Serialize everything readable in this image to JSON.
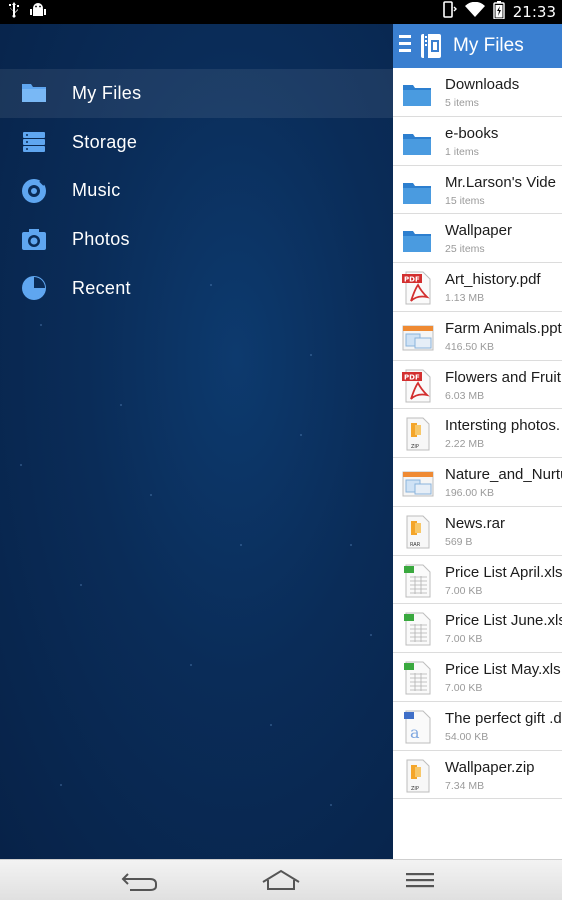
{
  "status_bar": {
    "time": "21:33",
    "left_icons": [
      "usb-icon",
      "android-debug-icon"
    ],
    "right_icons": [
      "rotation-icon",
      "wifi-icon",
      "battery-icon"
    ]
  },
  "drawer": {
    "items": [
      {
        "label": "My Files",
        "icon": "folder-icon",
        "active": true
      },
      {
        "label": "Storage",
        "icon": "storage-icon",
        "active": false
      },
      {
        "label": "Music",
        "icon": "music-icon",
        "active": false
      },
      {
        "label": "Photos",
        "icon": "camera-icon",
        "active": false
      },
      {
        "label": "Recent",
        "icon": "recent-icon",
        "active": false
      }
    ]
  },
  "action_bar": {
    "title": "My Files",
    "accent": "#3a7fd0"
  },
  "files": [
    {
      "name": "Downloads",
      "meta": "5 items",
      "type": "folder"
    },
    {
      "name": "e-books",
      "meta": "1 items",
      "type": "folder"
    },
    {
      "name": "Mr.Larson's Vide",
      "meta": "15 items",
      "type": "folder"
    },
    {
      "name": "Wallpaper",
      "meta": "25 items",
      "type": "folder"
    },
    {
      "name": "Art_history.pdf",
      "meta": "1.13 MB",
      "type": "pdf"
    },
    {
      "name": "Farm Animals.ppt",
      "meta": "416.50 KB",
      "type": "ppt"
    },
    {
      "name": "Flowers and Fruit",
      "meta": "6.03 MB",
      "type": "pdf"
    },
    {
      "name": "Intersting photos.",
      "meta": "2.22 MB",
      "type": "zip"
    },
    {
      "name": "Nature_and_Nurtu",
      "meta": "196.00 KB",
      "type": "ppt"
    },
    {
      "name": "News.rar",
      "meta": "569 B",
      "type": "rar"
    },
    {
      "name": "Price List April.xls",
      "meta": "7.00 KB",
      "type": "xls"
    },
    {
      "name": "Price List June.xls",
      "meta": "7.00 KB",
      "type": "xls"
    },
    {
      "name": "Price List May.xls",
      "meta": "7.00 KB",
      "type": "xls"
    },
    {
      "name": "The perfect gift .d",
      "meta": "54.00 KB",
      "type": "doc"
    },
    {
      "name": "Wallpaper.zip",
      "meta": "7.34 MB",
      "type": "zip"
    }
  ],
  "nav_bar": {
    "buttons": [
      "back-icon",
      "home-icon",
      "menu-icon"
    ]
  }
}
